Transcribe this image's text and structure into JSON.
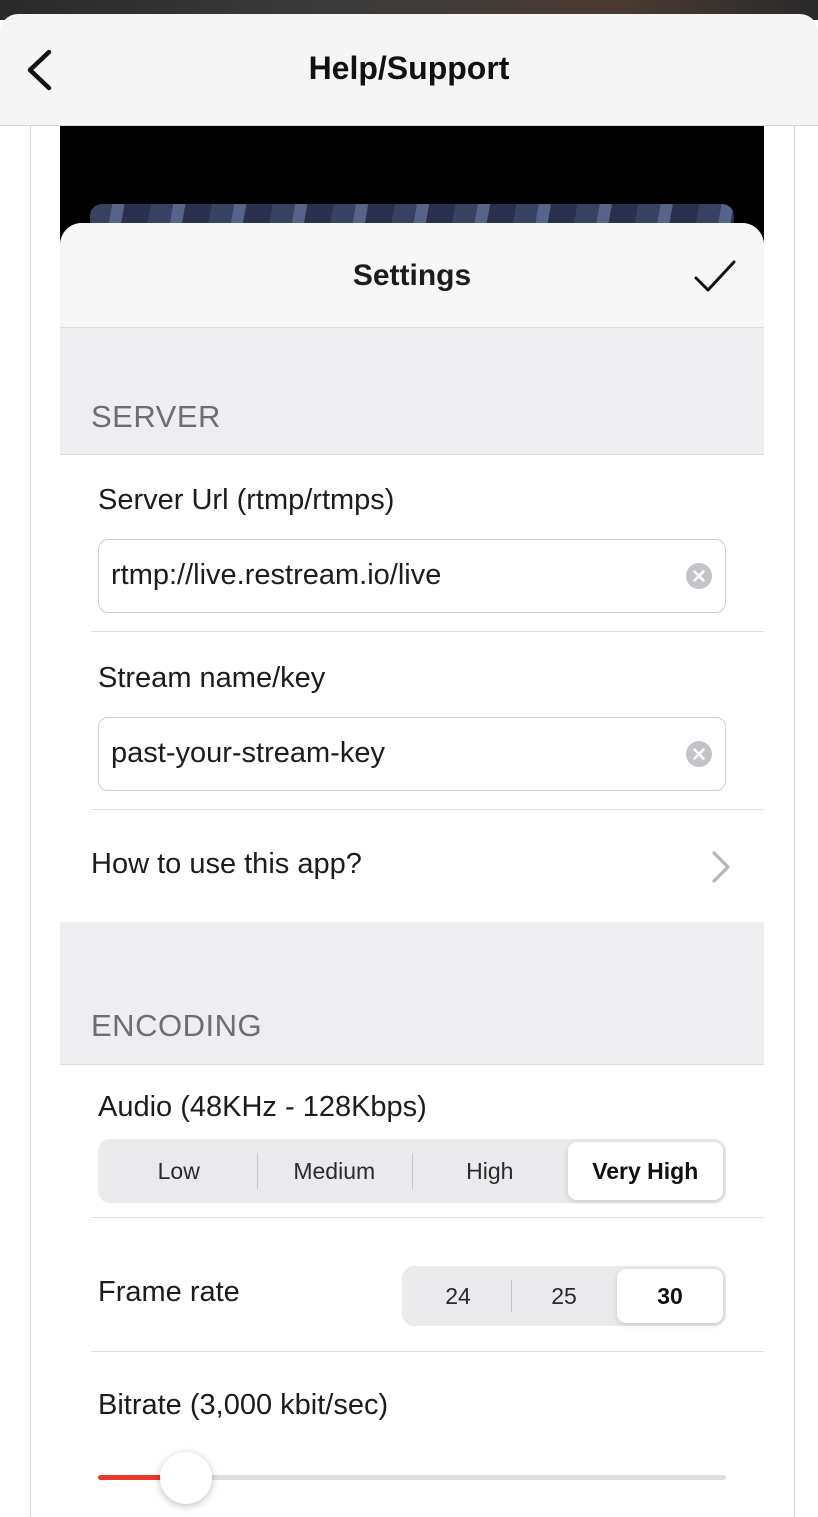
{
  "nav": {
    "title": "Help/Support",
    "back_icon": "chevron-left-icon"
  },
  "settings": {
    "title": "Settings",
    "done_icon": "checkmark-icon",
    "server": {
      "section_label": "SERVER",
      "url_label": "Server Url (rtmp/rtmps)",
      "url_value": "rtmp://live.restream.io/live",
      "key_label": "Stream name/key",
      "key_value": "past-your-stream-key",
      "help_link": "How to use this app?"
    },
    "encoding": {
      "section_label": "ENCODING",
      "audio_label": "Audio (48KHz - 128Kbps)",
      "audio_options": [
        "Low",
        "Medium",
        "High",
        "Very High"
      ],
      "audio_selected": "Very High",
      "framerate_label": "Frame rate",
      "framerate_options": [
        "24",
        "25",
        "30"
      ],
      "framerate_selected": "30",
      "bitrate_label": "Bitrate (3,000 kbit/sec)",
      "bitrate_level": 0.14
    }
  },
  "colors": {
    "accent": "#e8372c",
    "section_bg": "#eeeef0",
    "text": "#1c1c1e",
    "secondary_text": "#6d6d72"
  }
}
